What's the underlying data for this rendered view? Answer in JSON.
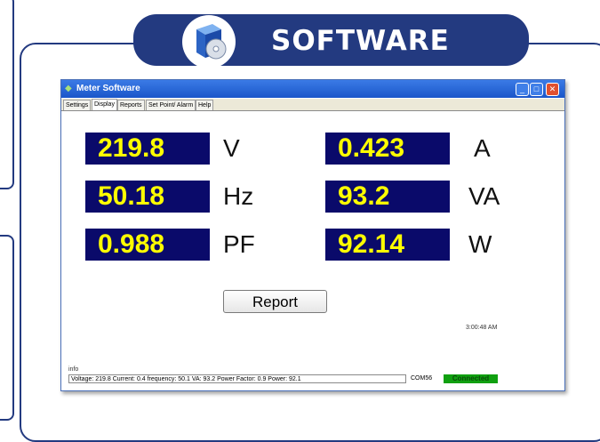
{
  "banner": {
    "title": "SOFTWARE",
    "icon": "software-box-icon"
  },
  "window": {
    "title": "Meter Software",
    "controls": {
      "minimize": "_",
      "maximize": "□",
      "close": "✕"
    }
  },
  "tabs": [
    "Settings",
    "Display",
    "Reports",
    "Set Point/ Alarm",
    "Help"
  ],
  "active_tab": "Display",
  "readings": {
    "voltage": {
      "value": "219.8",
      "unit": "V"
    },
    "current": {
      "value": "0.423",
      "unit": "A"
    },
    "frequency": {
      "value": "50.18",
      "unit": "Hz"
    },
    "apparent_power": {
      "value": "93.2",
      "unit": "VA"
    },
    "power_factor": {
      "value": "0.988",
      "unit": "PF"
    },
    "power": {
      "value": "92.14",
      "unit": "W"
    }
  },
  "report_button": "Report",
  "time": "3:00:48 AM",
  "info": {
    "label": "info",
    "text": "Voltage: 219.8 Current: 0.4 frequency: 50.1 VA: 93.2 Power Factor: 0.9 Power: 92.1"
  },
  "com_port": "COM56",
  "connection_status": "Connected",
  "colors": {
    "frame": "#233a80",
    "value_bg": "#0a0a6a",
    "value_text": "#ffff00",
    "connected": "#10a010"
  }
}
